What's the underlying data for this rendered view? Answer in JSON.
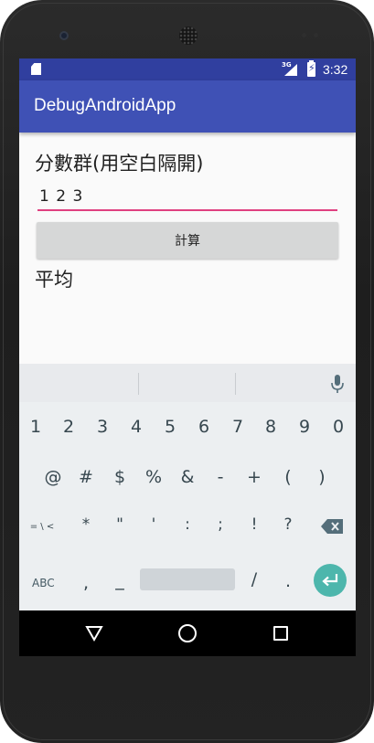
{
  "status_bar": {
    "network": "3G",
    "time": "3:32"
  },
  "app_bar": {
    "title": "DebugAndroidApp"
  },
  "content": {
    "scores_label": "分數群(用空白隔開)",
    "scores_input_value": "1 2 3",
    "calculate_button": "計算",
    "average_label": "平均"
  },
  "keyboard": {
    "number_row": [
      "1",
      "2",
      "3",
      "4",
      "5",
      "6",
      "7",
      "8",
      "9",
      "0"
    ],
    "symbol_row": [
      "@",
      "#",
      "$",
      "%",
      "&",
      "-",
      "+",
      "(",
      ")"
    ],
    "symbol_row2": [
      "= \\ <",
      "*",
      "\"",
      "'",
      ":",
      ";",
      "!",
      "?"
    ],
    "bottom_row": {
      "abc": "ABC",
      "comma": ",",
      "underscore": "_",
      "slash": "/",
      "period": "."
    }
  },
  "colors": {
    "status_bar": "#303f9f",
    "app_bar": "#3f51b5",
    "input_underline": "#e04080",
    "button_bg": "#d6d7d7",
    "enter_key": "#4db6ac"
  }
}
